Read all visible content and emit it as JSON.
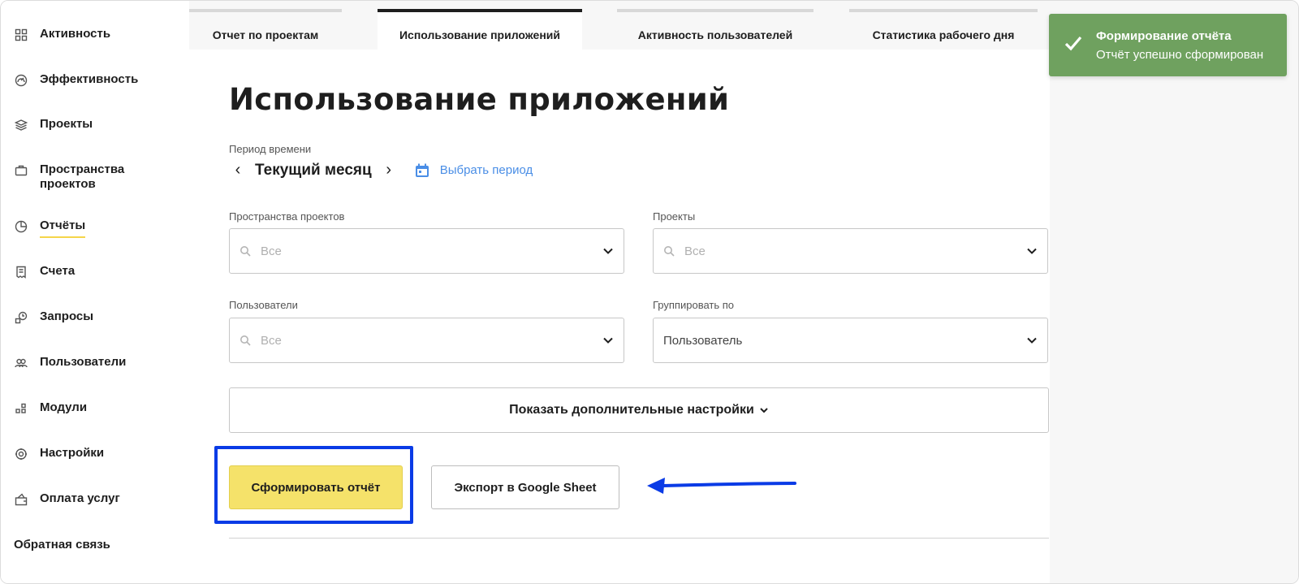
{
  "sidebar": {
    "items": [
      {
        "label": "Активность",
        "icon": "grid-icon"
      },
      {
        "label": "Эффективность",
        "icon": "gauge-icon"
      },
      {
        "label": "Проекты",
        "icon": "layers-icon"
      },
      {
        "label": "Пространства проектов",
        "icon": "briefcase-icon"
      },
      {
        "label": "Отчёты",
        "icon": "pie-chart-icon",
        "active": true
      },
      {
        "label": "Счета",
        "icon": "receipt-icon"
      },
      {
        "label": "Запросы",
        "icon": "requests-icon"
      },
      {
        "label": "Пользователи",
        "icon": "users-icon"
      },
      {
        "label": "Модули",
        "icon": "modules-icon"
      },
      {
        "label": "Настройки",
        "icon": "gear-icon"
      },
      {
        "label": "Оплата услуг",
        "icon": "payment-icon"
      }
    ],
    "feedback": "Обратная связь",
    "active_underline_color": "#f5d54a"
  },
  "tabs": [
    {
      "label": "Отчет по проектам"
    },
    {
      "label": "Использование приложений",
      "active": true
    },
    {
      "label": "Активность пользователей"
    },
    {
      "label": "Статистика рабочего дня"
    }
  ],
  "main": {
    "title": "Использование приложений",
    "period": {
      "label": "Период времени",
      "value": "Текущий месяц",
      "pick_label": "Выбрать период"
    },
    "filters": {
      "spaces": {
        "label": "Пространства проектов",
        "placeholder": "Все"
      },
      "projects": {
        "label": "Проекты",
        "placeholder": "Все"
      },
      "users": {
        "label": "Пользователи",
        "placeholder": "Все"
      },
      "group_by": {
        "label": "Группировать по",
        "value": "Пользователь"
      }
    },
    "more_settings": "Показать дополнительные настройки",
    "generate_button": "Сформировать отчёт",
    "export_button": "Экспорт в Google Sheet"
  },
  "toast": {
    "title": "Формирование отчёта",
    "message": "Отчёт успешно сформирован",
    "color": "#6fa15f"
  },
  "colors": {
    "accent_yellow": "#f5e26a",
    "link_blue": "#4a8ee6",
    "annotation_blue": "#0a3be6"
  }
}
